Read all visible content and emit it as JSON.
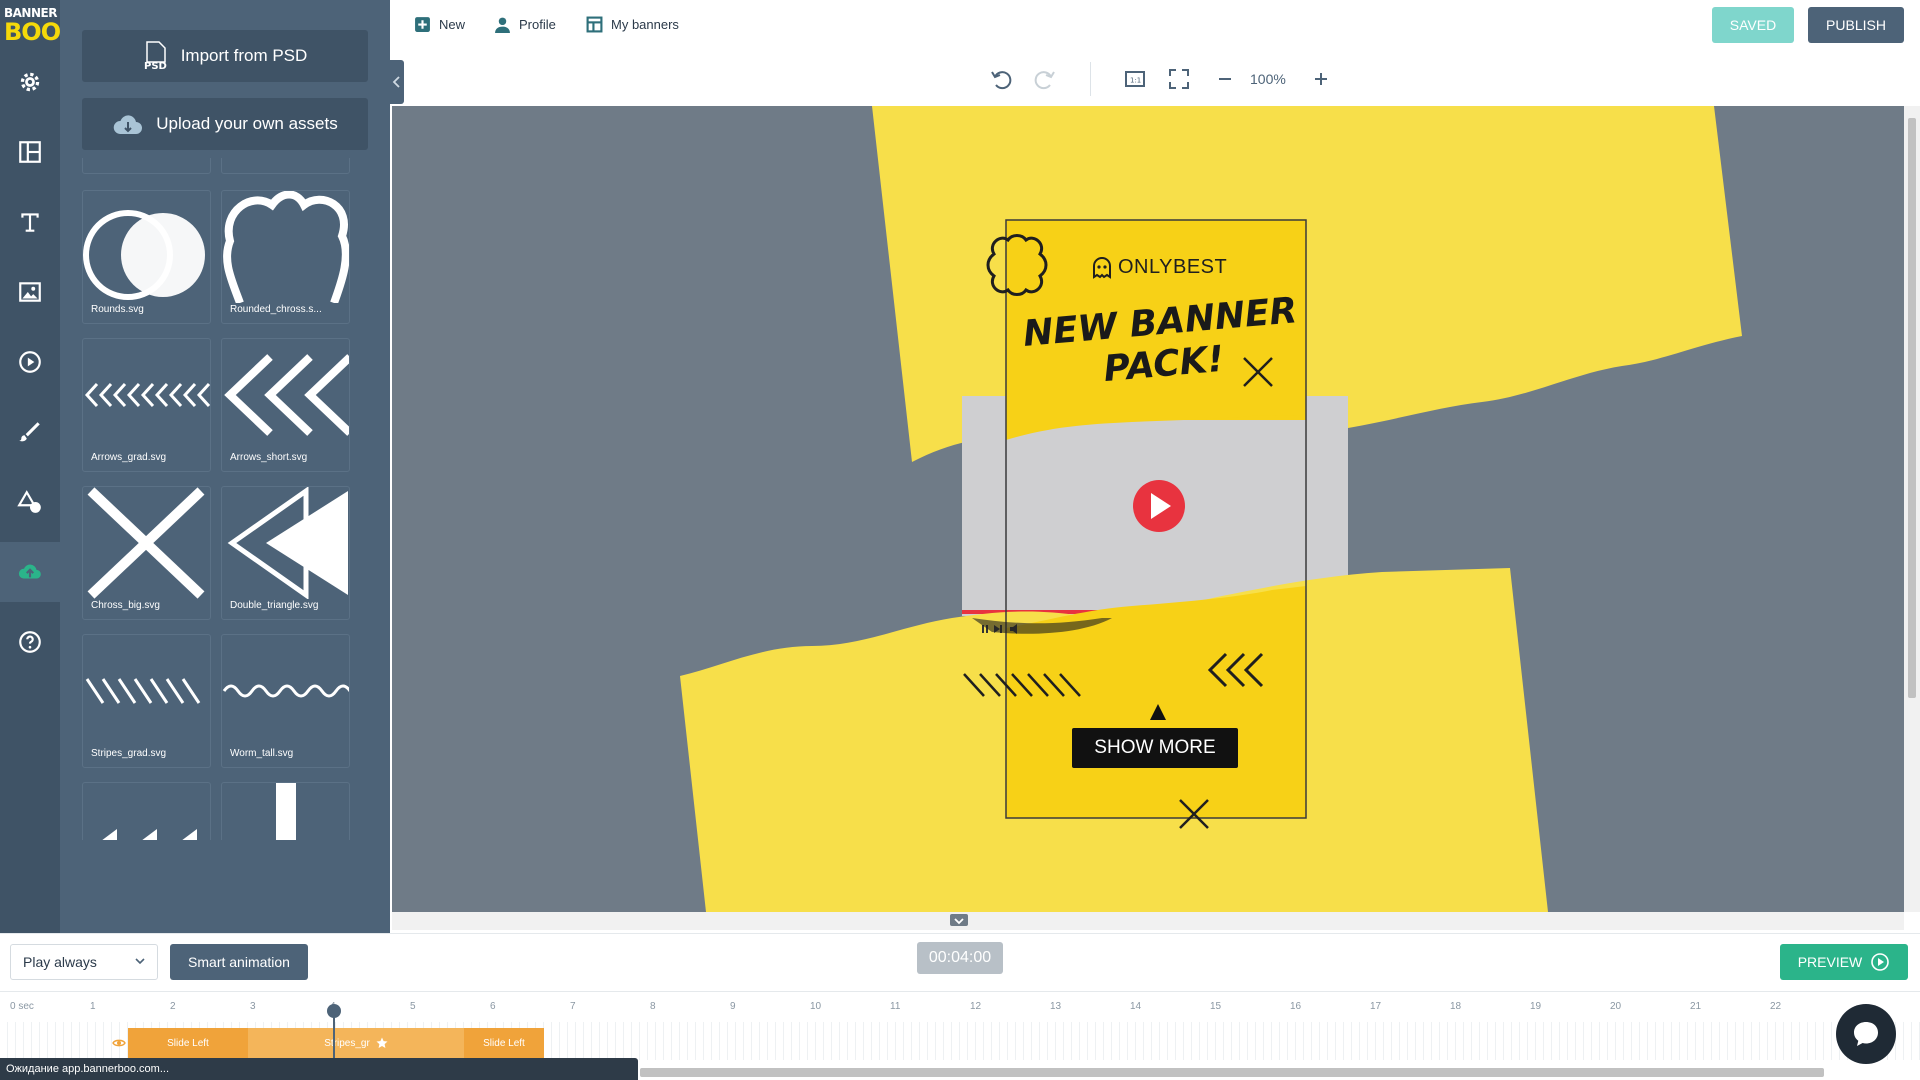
{
  "brand": {
    "logo_line1": "BANNER",
    "logo_line2": "BOO"
  },
  "rail": {
    "items": [
      {
        "name": "settings",
        "icon": "gear-icon"
      },
      {
        "name": "layouts",
        "icon": "layout-icon"
      },
      {
        "name": "text",
        "icon": "text-icon"
      },
      {
        "name": "images",
        "icon": "image-icon"
      },
      {
        "name": "video",
        "icon": "play-circle-icon"
      },
      {
        "name": "draw",
        "icon": "brush-icon"
      },
      {
        "name": "shapes",
        "icon": "shapes-icon"
      },
      {
        "name": "uploads",
        "icon": "cloud-upload-icon",
        "active": true
      },
      {
        "name": "help",
        "icon": "help-icon"
      }
    ]
  },
  "panel": {
    "import_label": "Import from PSD",
    "upload_label": "Upload your own assets",
    "assets": [
      {
        "name": "Rounds.svg"
      },
      {
        "name": "Rounded_chross.s..."
      },
      {
        "name": "Arrows_grad.svg"
      },
      {
        "name": "Arrows_short.svg"
      },
      {
        "name": "Chross_big.svg"
      },
      {
        "name": "Double_triangle.svg"
      },
      {
        "name": "Stripes_grad.svg"
      },
      {
        "name": "Worm_tall.svg"
      }
    ]
  },
  "topbar": {
    "new_label": "New",
    "profile_label": "Profile",
    "my_banners_label": "My banners",
    "saved_label": "SAVED",
    "publish_label": "PUBLISH"
  },
  "toolbar": {
    "zoom": "100%"
  },
  "banner": {
    "brand": "ONLYBEST",
    "headline_line1": "NEW BANNER",
    "headline_line2": "PACK!",
    "cta": "SHOW MORE",
    "colors": {
      "yellow": "#f7d117",
      "light_yellow": "#f7df4a",
      "canvas": "#6f7b87",
      "play": "#e8333f"
    }
  },
  "bottombar": {
    "play_mode": "Play always",
    "smart_animation_label": "Smart animation",
    "time": "00:04:00",
    "preview_label": "PREVIEW"
  },
  "timeline": {
    "ticks": [
      "0 sec",
      "1",
      "2",
      "3",
      "4",
      "5",
      "6",
      "7",
      "8",
      "9",
      "10",
      "11",
      "12",
      "13",
      "14",
      "15",
      "16",
      "17",
      "18",
      "19",
      "20",
      "21",
      "22"
    ],
    "clips": [
      {
        "label": "Slide Left"
      },
      {
        "label": "Stripes_gr"
      },
      {
        "label": "Slide Left"
      }
    ]
  },
  "status_text": "Ожидание app.bannerboo.com..."
}
